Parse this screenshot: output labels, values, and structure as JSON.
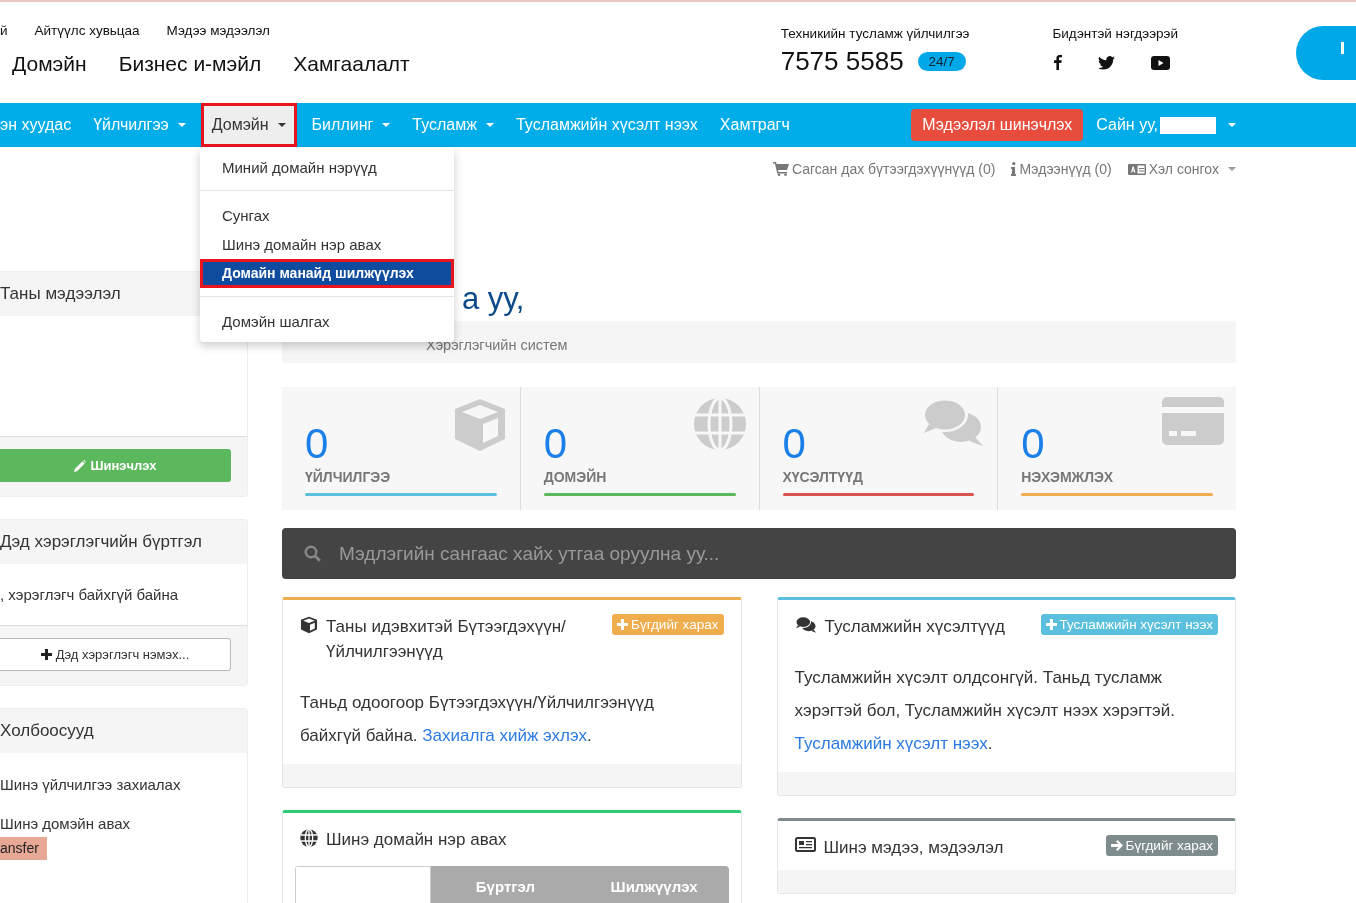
{
  "top_links": [
    "й",
    "Айтүүлс хувьцаа",
    "Мэдээ мэдээлэл"
  ],
  "main_menu": [
    "Домэйн",
    "Бизнес и-мэйл",
    "Хамгаалалт"
  ],
  "support": {
    "label": "Техникийн тусламж үйлчилгээ",
    "phone": "7575 5585",
    "badge": "24/7"
  },
  "social": {
    "label": "Бидэнтэй нэгдээрэй"
  },
  "nav": [
    {
      "label": "эн хуудас",
      "caret": false,
      "selected": false
    },
    {
      "label": "Үйлчилгээ",
      "caret": true,
      "selected": false
    },
    {
      "label": "Домэйн",
      "caret": true,
      "selected": true,
      "highlighted": true
    },
    {
      "label": "Биллинг",
      "caret": true,
      "selected": false
    },
    {
      "label": "Тусламж",
      "caret": true,
      "selected": false
    },
    {
      "label": "Тусламжийн хүсэлт нээх",
      "caret": false,
      "selected": false
    },
    {
      "label": "Хамтрагч",
      "caret": false,
      "selected": false
    }
  ],
  "update_button": "Мэдээлэл шинэчлэх",
  "greeting": "Сайн уу,",
  "dropdown": [
    [
      {
        "label": "Миний домайн нэрүүд",
        "selected": false,
        "highlighted": false
      }
    ],
    [
      {
        "label": "Сунгах",
        "selected": false,
        "highlighted": false
      },
      {
        "label": "Шинэ домайн нэр авах",
        "selected": false,
        "highlighted": false
      },
      {
        "label": "Домайн манайд шилжүүлэх",
        "selected": true,
        "highlighted": true
      }
    ],
    [
      {
        "label": "Домэйн шалгах",
        "selected": false,
        "highlighted": false
      }
    ]
  ],
  "utility_links": [
    {
      "label": "Сагсан дах бүтээгдэхүүнүүд (0)",
      "caret": false
    },
    {
      "label": "Мэдээнүүд (0)",
      "caret": false
    },
    {
      "label": "Хэл сонгох",
      "caret": true
    }
  ],
  "heading": "а уу,",
  "breadcrumb": [
    "Хэрэглэгчийн систем"
  ],
  "sidebar": {
    "info": {
      "title": "Таны мэдээлэл",
      "button": "Шинэчлэх"
    },
    "subaccounts": {
      "title": "Дэд хэрэглэгчийн бүртгэл",
      "text": ", хэрэглэгч байхгүй байна",
      "button": "Дэд хэрэглэгч нэмэх..."
    },
    "links": {
      "title": "Холбоосууд",
      "items": [
        "Шинэ үйлчилгээ захиалах",
        "Шинэ домэйн авах"
      ]
    },
    "badge": "ansfer"
  },
  "stats": [
    {
      "value": "0",
      "label": "ҮЙЛЧИЛГЭЭ",
      "color": "#5bc0de"
    },
    {
      "value": "0",
      "label": "ДОМЭЙН",
      "color": "#5cb85c"
    },
    {
      "value": "0",
      "label": "ХҮСЭЛТҮҮД",
      "color": "#d9534f"
    },
    {
      "value": "0",
      "label": "НЭХЭМЖЛЭХ",
      "color": "#f0ad4e"
    }
  ],
  "search": {
    "placeholder": "Мэдлэгийн сангаас хайх утгаа оруулна уу..."
  },
  "panels": [
    {
      "title": "Таны идэвхитэй Бүтээгдэхүүн/ Үйлчилгээнүүд",
      "color": "#f0ad4e",
      "button": "Бүгдийг харах",
      "body": "Таньд одоогоор Бүтээгдэхүүн/Үйлчилгээнүүд байхгүй байна.",
      "link": "Захиалга хийж эхлэх",
      "link_suffix": "."
    },
    {
      "title": "Тусламжийн хүсэлтүүд",
      "color": "#5bc0de",
      "button": "Тусламжийн хүсэлт нээх",
      "body": "Тусламжийн хүсэлт олдсонгүй. Таньд тусламж хэрэгтэй бол, Тусламжийн хүсэлт нээх хэрэгтэй.",
      "link": "Тусламжийн хүсэлт нээх",
      "link_suffix": "."
    },
    {
      "title": "Шинэ домайн нэр авах",
      "color": "#2ecc71",
      "tabs": [
        {
          "label": "Бүртгэл",
          "selected": false
        },
        {
          "label": "Шилжүүлэх",
          "selected": false
        }
      ]
    },
    {
      "title": "Шинэ мэдээ, мэдээлэл",
      "color": "#7f8c8d",
      "button": "Бүгдийг харах"
    }
  ]
}
